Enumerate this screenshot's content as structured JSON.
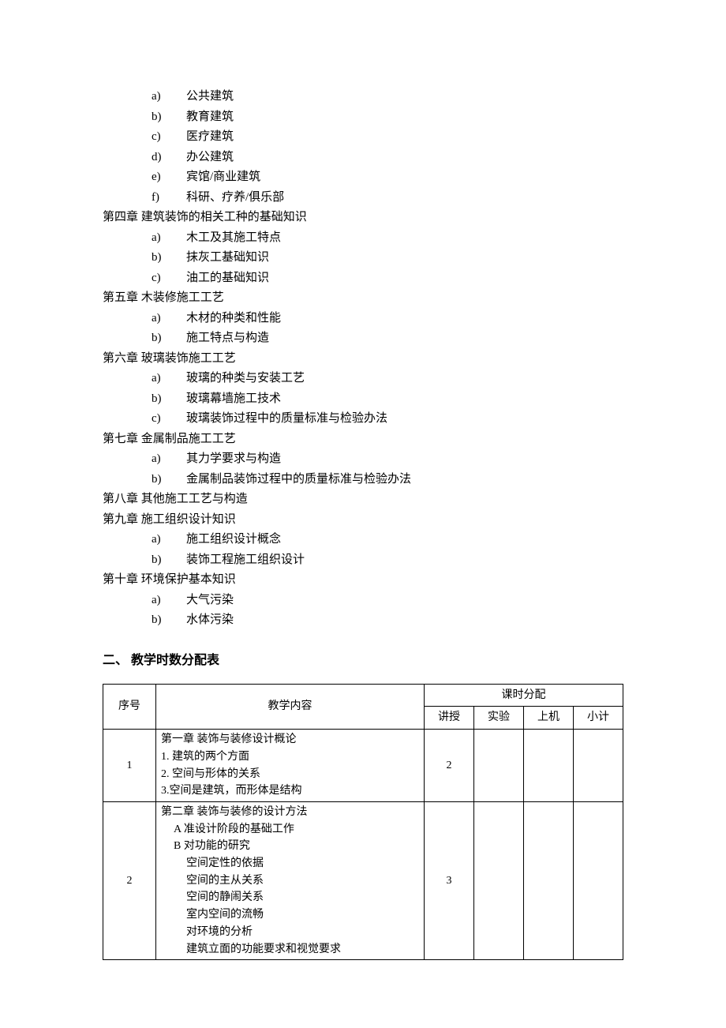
{
  "outline": {
    "pre_items": [
      {
        "marker": "a)",
        "text": "公共建筑"
      },
      {
        "marker": "b)",
        "text": "教育建筑"
      },
      {
        "marker": "c)",
        "text": "医疗建筑"
      },
      {
        "marker": "d)",
        "text": "办公建筑"
      },
      {
        "marker": "e)",
        "text": "宾馆/商业建筑"
      },
      {
        "marker": "f)",
        "text": "科研、疗养/俱乐部"
      }
    ],
    "chapters": [
      {
        "title": "第四章 建筑装饰的相关工种的基础知识",
        "items": [
          {
            "marker": "a)",
            "text": "木工及其施工特点"
          },
          {
            "marker": "b)",
            "text": "抹灰工基础知识"
          },
          {
            "marker": "c)",
            "text": "油工的基础知识"
          }
        ]
      },
      {
        "title": "第五章 木装修施工工艺",
        "items": [
          {
            "marker": "a)",
            "text": "木材的种类和性能"
          },
          {
            "marker": "b)",
            "text": "施工特点与构造"
          }
        ]
      },
      {
        "title": "第六章 玻璃装饰施工工艺",
        "items": [
          {
            "marker": "a)",
            "text": "玻璃的种类与安装工艺"
          },
          {
            "marker": "b)",
            "text": "玻璃幕墙施工技术"
          },
          {
            "marker": "c)",
            "text": "玻璃装饰过程中的质量标准与检验办法"
          }
        ]
      },
      {
        "title": "第七章 金属制品施工工艺",
        "items": [
          {
            "marker": "a)",
            "text": "其力学要求与构造"
          },
          {
            "marker": "b)",
            "text": "金属制品装饰过程中的质量标准与检验办法"
          }
        ]
      },
      {
        "title": "第八章 其他施工工艺与构造",
        "items": []
      },
      {
        "title": "第九章 施工组织设计知识",
        "items": [
          {
            "marker": "a)",
            "text": "施工组织设计概念"
          },
          {
            "marker": "b)",
            "text": "装饰工程施工组织设计"
          }
        ]
      },
      {
        "title": "第十章 环境保护基本知识",
        "items": [
          {
            "marker": "a)",
            "text": "大气污染"
          },
          {
            "marker": "b)",
            "text": "水体污染"
          }
        ]
      }
    ]
  },
  "section2_title": "二、 教学时数分配表",
  "table": {
    "headers": {
      "seq": "序号",
      "content": "教学内容",
      "hours_group": "课时分配",
      "lecture": "讲授",
      "lab": "实验",
      "computer": "上机",
      "subtotal": "小计"
    },
    "rows": [
      {
        "seq": "1",
        "content_lines": [
          {
            "text": "第一章 装饰与装修设计概论",
            "indent": 0
          },
          {
            "text": "1. 建筑的两个方面",
            "indent": 0
          },
          {
            "text": "2. 空间与形体的关系",
            "indent": 0
          },
          {
            "text": "3.空间是建筑，而形体是结构",
            "indent": 0
          }
        ],
        "lecture": "2",
        "lab": "",
        "computer": "",
        "subtotal": ""
      },
      {
        "seq": "2",
        "content_lines": [
          {
            "text": "第二章 装饰与装修的设计方法",
            "indent": 0
          },
          {
            "text": "A 准设计阶段的基础工作",
            "indent": 1
          },
          {
            "text": "B 对功能的研究",
            "indent": 1
          },
          {
            "text": "空间定性的依据",
            "indent": 2
          },
          {
            "text": "空间的主从关系",
            "indent": 2
          },
          {
            "text": "空间的静闹关系",
            "indent": 2
          },
          {
            "text": "室内空间的流畅",
            "indent": 2
          },
          {
            "text": "对环境的分析",
            "indent": 2
          },
          {
            "text": "建筑立面的功能要求和视觉要求",
            "indent": 2
          }
        ],
        "lecture": "3",
        "lab": "",
        "computer": "",
        "subtotal": ""
      }
    ]
  }
}
